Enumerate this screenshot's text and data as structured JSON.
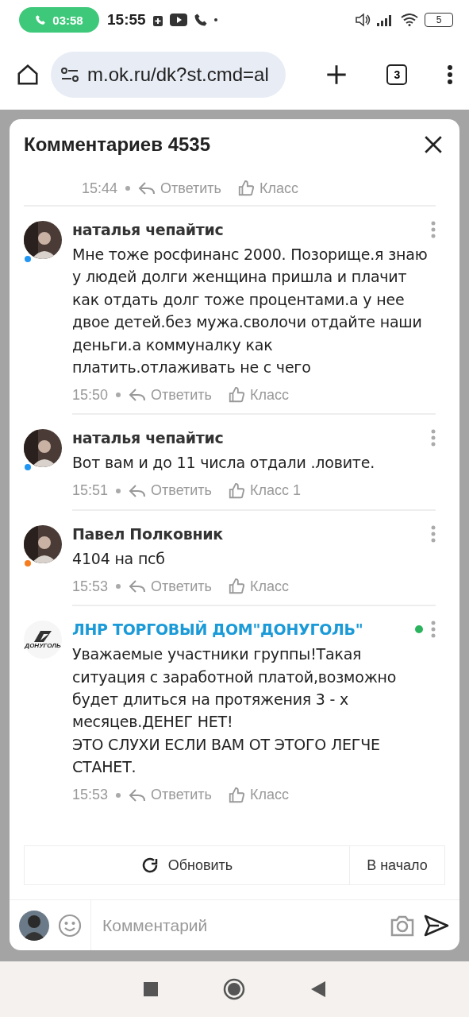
{
  "status_bar": {
    "call_timer": "03:58",
    "time": "15:55",
    "battery": "5"
  },
  "browser": {
    "url": "m.ok.ru/dk?st.cmd=al",
    "tab_count": "3"
  },
  "modal": {
    "title": "Комментариев 4535",
    "top_meta": {
      "time": "15:44",
      "reply": "Ответить",
      "like": "Класс"
    },
    "comments": [
      {
        "kind": "person",
        "author": "наталья чепайтис",
        "color": "#2196f3",
        "online": false,
        "text": "Мне тоже росфинанс 2000. Позорище.я знаю у людей долги женщина пришла и плачит как отдать долг тоже процентами.а у нее двое детей.без мужа.сволочи отдайте наши деньги.а коммуналку как платить.отлаживать не с чего",
        "time": "15:50",
        "reply": "Ответить",
        "like": "Класс"
      },
      {
        "kind": "person",
        "author": "наталья чепайтис",
        "color": "#2196f3",
        "online": false,
        "text": "Вот вам и до 11 числа отдали .ловите.",
        "time": "15:51",
        "reply": "Ответить",
        "like": "Класс 1"
      },
      {
        "kind": "person",
        "author": "Павел Полковник",
        "color": "#f57c1f",
        "online": false,
        "text": "4104 на псб",
        "time": "15:53",
        "reply": "Ответить",
        "like": "Класс"
      },
      {
        "kind": "group",
        "author": "ЛНР ТОРГОВЫЙ ДОМ\"ДОНУГОЛЬ\"",
        "logo_text": "ДОНУГОЛЬ",
        "online": true,
        "text": "Уважаемые участники группы!Такая ситуация с заработной платой,возможно будет длиться на протяжения 3 - х месяцев.ДЕНЕГ НЕТ!\nЭТО СЛУХИ ЕСЛИ ВАМ ОТ ЭТОГО ЛЕГЧЕ СТАНЕТ.",
        "time": "15:53",
        "reply": "Ответить",
        "like": "Класс"
      }
    ],
    "refresh_button": "Обновить",
    "top_button": "В начало",
    "composer": {
      "placeholder": "Комментарий"
    }
  }
}
